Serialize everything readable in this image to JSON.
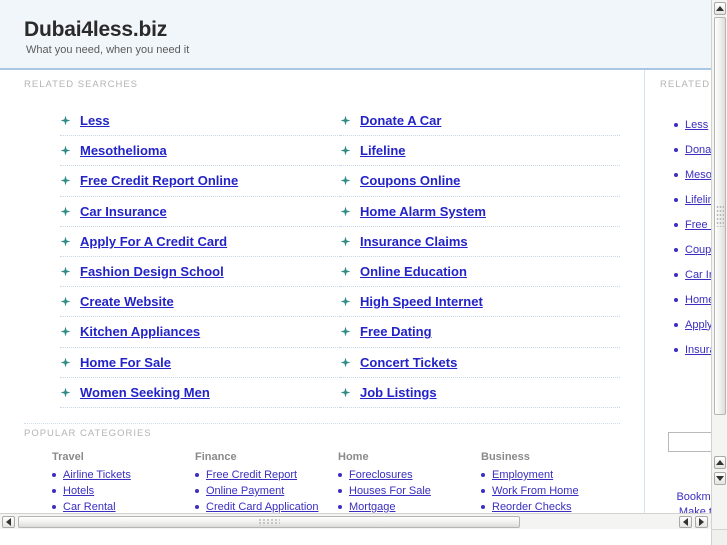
{
  "header": {
    "title": "Dubai4less.biz",
    "tagline": "What you need, when you need it"
  },
  "related": {
    "label": "RELATED SEARCHES",
    "left_column": [
      "Less",
      "Mesothelioma",
      "Free Credit Report Online",
      "Car Insurance",
      "Apply For A Credit Card",
      "Fashion Design School",
      "Create Website",
      "Kitchen Appliances",
      "Home For Sale",
      "Women Seeking Men"
    ],
    "right_column": [
      "Donate A Car",
      "Lifeline",
      "Coupons Online",
      "Home Alarm System",
      "Insurance Claims",
      "Online Education",
      "High Speed Internet",
      "Free Dating",
      "Concert Tickets",
      "Job Listings"
    ],
    "bullet_icon": "green-star-bullet-icon"
  },
  "categories": {
    "label": "POPULAR CATEGORIES",
    "groups": [
      {
        "heading": "Travel",
        "items": [
          "Airline Tickets",
          "Hotels",
          "Car Rental"
        ]
      },
      {
        "heading": "Finance",
        "items": [
          "Free Credit Report",
          "Online Payment",
          "Credit Card Application"
        ]
      },
      {
        "heading": "Home",
        "items": [
          "Foreclosures",
          "Houses For Sale",
          "Mortgage"
        ]
      },
      {
        "heading": "Business",
        "items": [
          "Employment",
          "Work From Home",
          "Reorder Checks"
        ]
      }
    ]
  },
  "sidebar": {
    "label": "RELATED",
    "items": [
      "Less",
      "Donate A Car",
      "Mesothelioma",
      "Lifeline",
      "Free Credit Report Online",
      "Coupons Online",
      "Car Insurance",
      "Home Alarm System",
      "Apply For A Credit Card",
      "Insurance Claims"
    ],
    "search_value": "",
    "search_placeholder": "",
    "footer_links": [
      "Bookmark",
      "Make this"
    ]
  },
  "colors": {
    "link": "#2323c8",
    "sidebar_link": "#3a2fc0",
    "bullet_green": "#2e8b84",
    "header_bg": "#f0f6fa",
    "header_rule": "#a9c6e2",
    "label_gray": "#b4b4b4"
  },
  "scrollbars": {
    "vertical_up_icon": "scroll-up-arrow-icon",
    "vertical_down_icon": "scroll-down-arrow-icon",
    "horizontal_left_icon": "scroll-left-arrow-icon",
    "horizontal_right_icon": "scroll-right-arrow-icon"
  }
}
